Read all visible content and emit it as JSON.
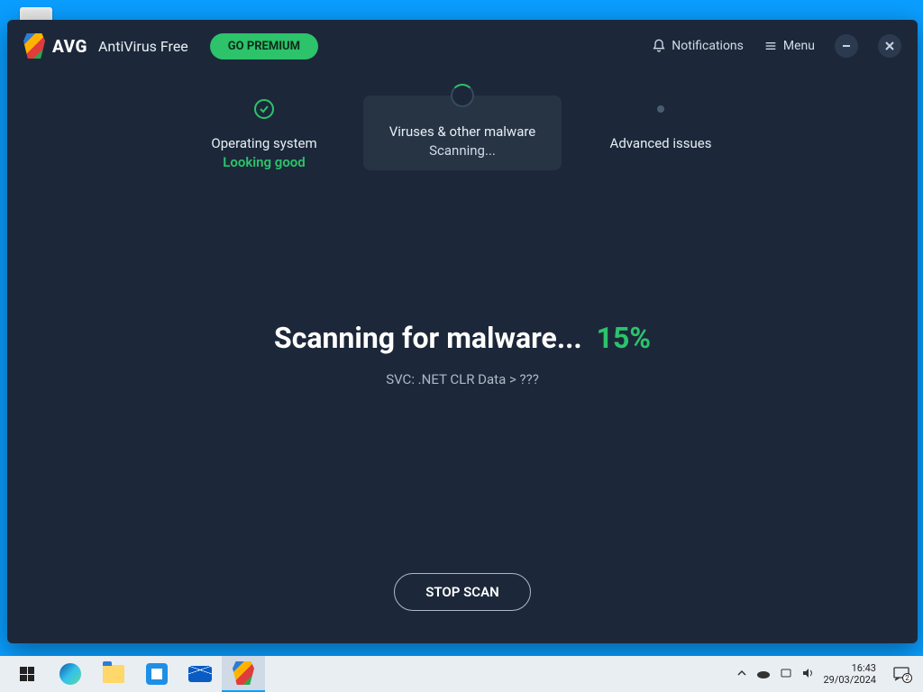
{
  "header": {
    "brand": "AVG",
    "product": "AntiVirus Free",
    "premium_label": "GO PREMIUM",
    "notifications_label": "Notifications",
    "menu_label": "Menu"
  },
  "stepper": {
    "step1": {
      "title": "Operating system",
      "status": "Looking good"
    },
    "step2": {
      "title": "Viruses & other malware",
      "status": "Scanning..."
    },
    "step3": {
      "title": "Advanced issues"
    }
  },
  "scan": {
    "title": "Scanning for malware...",
    "percent": "15%",
    "detail": "SVC: .NET CLR Data > ???",
    "stop_label": "STOP SCAN"
  },
  "taskbar": {
    "time": "16:43",
    "date": "29/03/2024",
    "action_count": "2"
  }
}
